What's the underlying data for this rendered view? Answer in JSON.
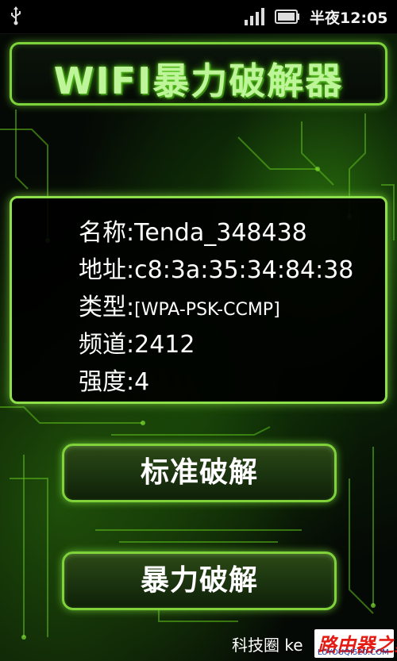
{
  "status_bar": {
    "time": "半夜12:05",
    "icons": [
      "usb-icon",
      "signal-icon",
      "battery-icon"
    ]
  },
  "app": {
    "title": "WIFI暴力破解器",
    "accent_color": "#7cd43a"
  },
  "network_info": [
    {
      "label": "名称:",
      "value": "Tenda_348438"
    },
    {
      "label": "地址:",
      "value": "c8:3a:35:34:84:38"
    },
    {
      "label": "类型:",
      "value": "[WPA-PSK-CCMP]"
    },
    {
      "label": "频道:",
      "value": "2412"
    },
    {
      "label": "强度:",
      "value": "4"
    }
  ],
  "buttons": {
    "standard_crack": "标准破解",
    "brute_crack": "暴力破解"
  },
  "watermark": {
    "text": "科技圈  ke",
    "brand": "路由器之家",
    "url": "LUYOUQI520.COM"
  }
}
